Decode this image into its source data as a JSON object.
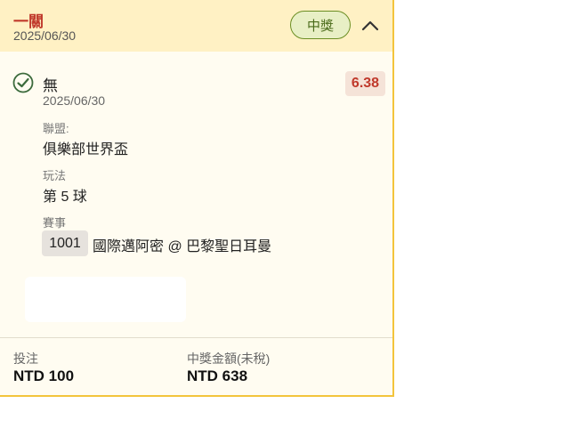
{
  "ticket": {
    "type": "一關",
    "date": "2025/06/30",
    "status_badge": "中獎",
    "selection": {
      "pick": "無",
      "date": "2025/06/30",
      "odds": "6.38",
      "league_label": "聯盟:",
      "league": "俱樂部世界盃",
      "play_label": "玩法",
      "play": "第 5 球",
      "event_label": "賽事",
      "match_code": "1001",
      "match_name": "國際邁阿密 @ 巴黎聖日耳曼"
    },
    "footer": {
      "stake_label": "投注",
      "stake_value": "NTD 100",
      "payout_label": "中獎金額(未稅)",
      "payout_value": "NTD 638"
    }
  },
  "icons": {
    "status": "check-circle-icon",
    "collapse": "chevron-up-icon"
  },
  "colors": {
    "accent": "#c0392b",
    "win": "#4a6b1a",
    "border": "#f3c43c"
  }
}
